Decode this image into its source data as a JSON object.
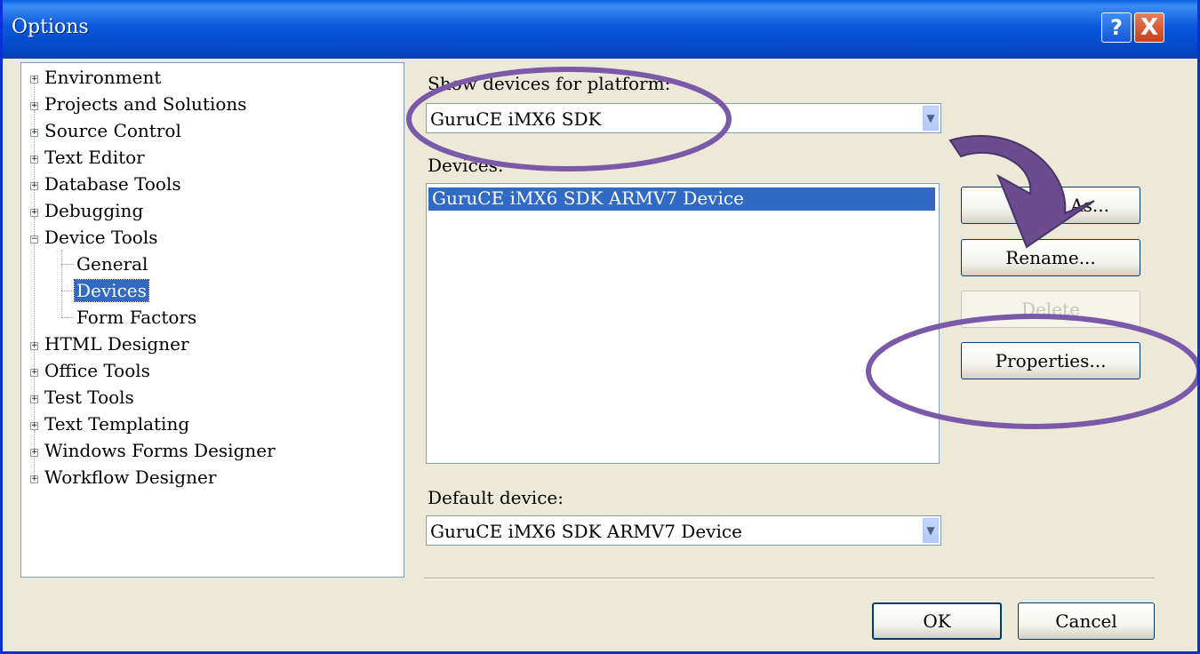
{
  "window": {
    "title": "Options",
    "help_glyph": "?",
    "close_glyph": "X"
  },
  "tree": {
    "items": [
      {
        "label": "Environment"
      },
      {
        "label": "Projects and Solutions"
      },
      {
        "label": "Source Control"
      },
      {
        "label": "Text Editor"
      },
      {
        "label": "Database Tools"
      },
      {
        "label": "Debugging"
      },
      {
        "label": "Device Tools",
        "expanded": true
      },
      {
        "label": "General"
      },
      {
        "label": "Devices",
        "selected": true
      },
      {
        "label": "Form Factors"
      },
      {
        "label": "HTML Designer"
      },
      {
        "label": "Office Tools"
      },
      {
        "label": "Test Tools"
      },
      {
        "label": "Text Templating"
      },
      {
        "label": "Windows Forms Designer"
      },
      {
        "label": "Workflow Designer"
      }
    ]
  },
  "platform": {
    "label": "Show devices for platform:",
    "value": "GuruCE iMX6 SDK"
  },
  "devices": {
    "label": "Devices:",
    "items": [
      "GuruCE iMX6 SDK ARMV7 Device"
    ]
  },
  "buttons": {
    "save_as": "Save As...",
    "save_as_visible": "e As...",
    "rename": "Rename...",
    "delete": "Delete",
    "properties": "Properties...",
    "ok": "OK",
    "cancel": "Cancel"
  },
  "default_device": {
    "label": "Default device:",
    "value": "GuruCE iMX6 SDK ARMV7 Device"
  },
  "colors": {
    "annotation": "#7a5aa8",
    "selection": "#316ac5",
    "title_bar": "#0a58dc"
  }
}
